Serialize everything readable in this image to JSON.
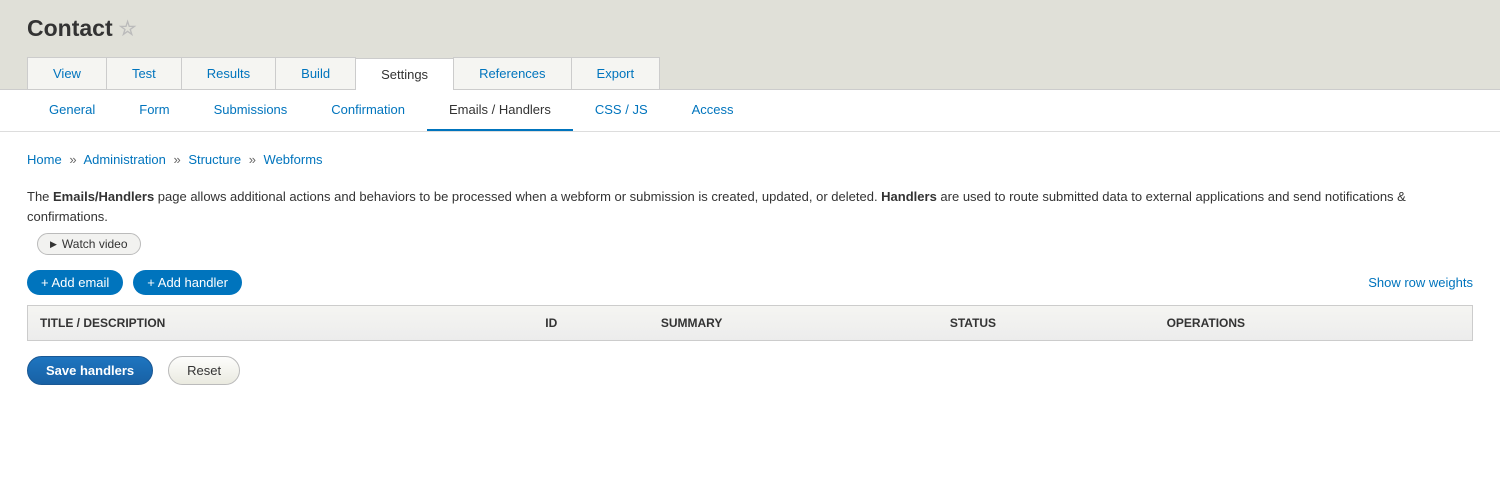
{
  "page_title": "Contact",
  "primary_tabs": [
    {
      "label": "View",
      "active": false
    },
    {
      "label": "Test",
      "active": false
    },
    {
      "label": "Results",
      "active": false
    },
    {
      "label": "Build",
      "active": false
    },
    {
      "label": "Settings",
      "active": true
    },
    {
      "label": "References",
      "active": false
    },
    {
      "label": "Export",
      "active": false
    }
  ],
  "secondary_tabs": [
    {
      "label": "General",
      "active": false
    },
    {
      "label": "Form",
      "active": false
    },
    {
      "label": "Submissions",
      "active": false
    },
    {
      "label": "Confirmation",
      "active": false
    },
    {
      "label": "Emails / Handlers",
      "active": true
    },
    {
      "label": "CSS / JS",
      "active": false
    },
    {
      "label": "Access",
      "active": false
    }
  ],
  "breadcrumb": [
    {
      "label": "Home"
    },
    {
      "label": "Administration"
    },
    {
      "label": "Structure"
    },
    {
      "label": "Webforms"
    }
  ],
  "description": {
    "part1": "The ",
    "bold1": "Emails/Handlers",
    "part2": " page allows additional actions and behaviors to be processed when a webform or submission is created, updated, or deleted. ",
    "bold2": "Handlers",
    "part3": " are used to route submitted data to external applications and send notifications & confirmations."
  },
  "watch_video_label": "Watch video",
  "add_email_label": "+ Add email",
  "add_handler_label": "+ Add handler",
  "show_weights_label": "Show row weights",
  "table_headers": {
    "title": "TITLE / DESCRIPTION",
    "id": "ID",
    "summary": "SUMMARY",
    "status": "STATUS",
    "operations": "OPERATIONS"
  },
  "save_button": "Save handlers",
  "reset_button": "Reset"
}
